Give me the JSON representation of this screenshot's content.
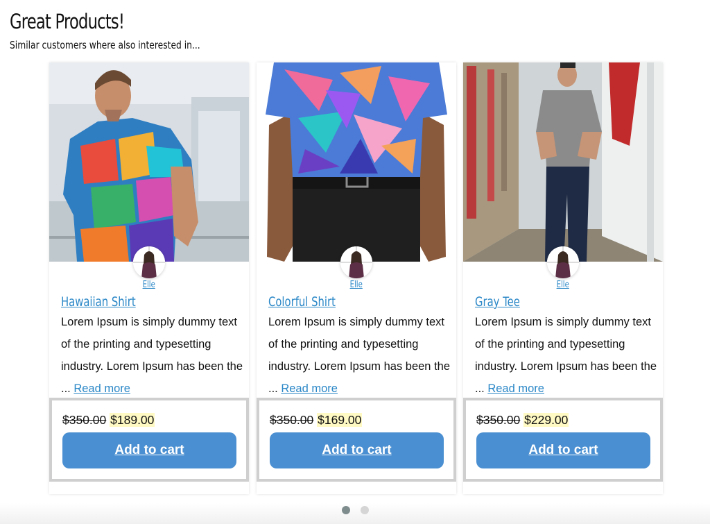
{
  "header": {
    "title": "Great Products!",
    "subtitle": "Similar customers where also interested in..."
  },
  "products": [
    {
      "image": "man-in-colorful-hawaiian-shirt-photo",
      "author": "Elle",
      "title": "Hawaiian Shirt",
      "description": "Lorem Ipsum is simply dummy text of the printing and typesetting industry. Lorem Ipsum has been the ... ",
      "read_more": "Read more",
      "old_price": "$350.00",
      "new_price": "$189.00",
      "button": "Add to cart"
    },
    {
      "image": "colorful-pattern-shirt-photo",
      "author": "Elle",
      "title": "Colorful Shirt",
      "description": "Lorem Ipsum is simply dummy text of the printing and typesetting industry. Lorem Ipsum has been the ... ",
      "read_more": "Read more",
      "old_price": "$350.00",
      "new_price": "$169.00",
      "button": "Add to cart"
    },
    {
      "image": "man-in-gray-tee-street-photo",
      "author": "Elle",
      "title": "Gray Tee",
      "description": "Lorem Ipsum is simply dummy text of the printing and typesetting industry. Lorem Ipsum has been the ... ",
      "read_more": "Read more",
      "old_price": "$350.00",
      "new_price": "$229.00",
      "button": "Add to cart"
    }
  ],
  "pagination": {
    "total_pages": 2,
    "active_page": 1,
    "active_color": "#7f8c8d",
    "inactive_color": "#d5d5d5"
  },
  "colors": {
    "link": "#2a87c7",
    "button": "#4a8fd1",
    "price_highlight": "#fff9c4",
    "price_box_border": "#cfcfcf"
  }
}
